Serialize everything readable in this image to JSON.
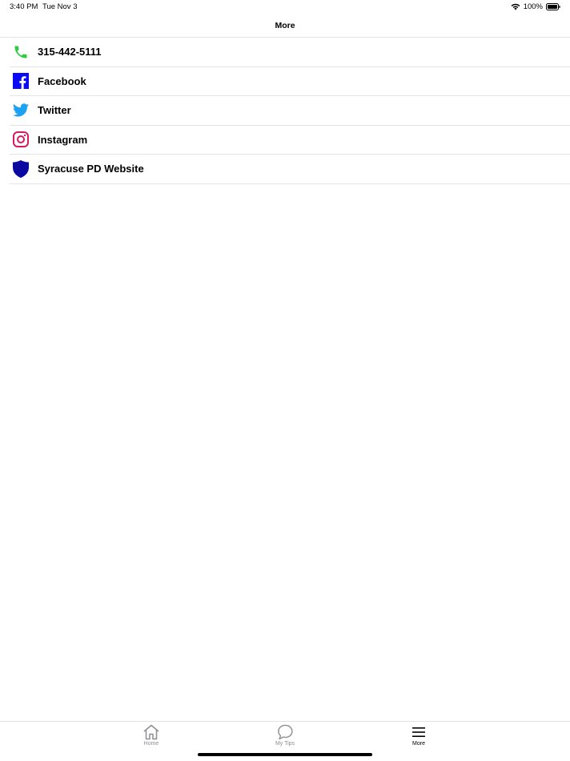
{
  "status_bar": {
    "time": "3:40 PM",
    "date": "Tue Nov 3",
    "battery": "100%",
    "icons": [
      "wifi-icon",
      "battery-icon"
    ]
  },
  "nav": {
    "title": "More"
  },
  "items": [
    {
      "label": "315-442-5111",
      "icon": "phone-icon",
      "color": "#2ecc40"
    },
    {
      "label": "Facebook",
      "icon": "facebook-icon",
      "color": "#0a0af5"
    },
    {
      "label": "Twitter",
      "icon": "twitter-icon",
      "color": "#1da1f2"
    },
    {
      "label": "Instagram",
      "icon": "instagram-icon",
      "color": "#d81b60"
    },
    {
      "label": "Syracuse PD Website",
      "icon": "shield-icon",
      "color": "#0a0aa0"
    }
  ],
  "tabs": [
    {
      "label": "Home",
      "icon": "home-icon",
      "active": false
    },
    {
      "label": "My Tips",
      "icon": "chat-bubble-icon",
      "active": false
    },
    {
      "label": "More",
      "icon": "menu-icon",
      "active": true
    }
  ]
}
